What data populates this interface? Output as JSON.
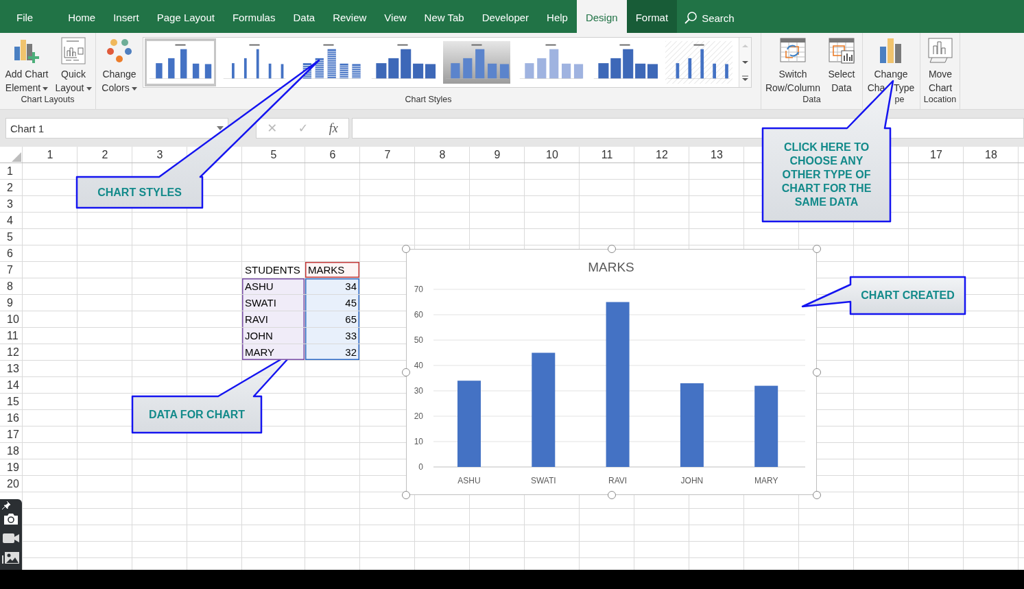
{
  "tabs": [
    {
      "label": "File",
      "selected": false,
      "contextual": false
    },
    {
      "label": "Home",
      "selected": false,
      "contextual": false
    },
    {
      "label": "Insert",
      "selected": false,
      "contextual": false
    },
    {
      "label": "Page Layout",
      "selected": false,
      "contextual": false
    },
    {
      "label": "Formulas",
      "selected": false,
      "contextual": false
    },
    {
      "label": "Data",
      "selected": false,
      "contextual": false
    },
    {
      "label": "Review",
      "selected": false,
      "contextual": false
    },
    {
      "label": "View",
      "selected": false,
      "contextual": false
    },
    {
      "label": "New Tab",
      "selected": false,
      "contextual": false
    },
    {
      "label": "Developer",
      "selected": false,
      "contextual": false
    },
    {
      "label": "Help",
      "selected": false,
      "contextual": false
    },
    {
      "label": "Design",
      "selected": true,
      "contextual": true
    },
    {
      "label": "Format",
      "selected": false,
      "contextual": true
    }
  ],
  "search": {
    "label": "Search"
  },
  "ribbon": {
    "groups": [
      {
        "label": "Chart Layouts",
        "buttons": [
          {
            "label": "Add Chart Element",
            "dropdown": true,
            "kind": "add-element"
          },
          {
            "label": "Quick Layout",
            "dropdown": true,
            "kind": "quick-layout"
          }
        ]
      },
      {
        "label": "Chart Styles",
        "buttons": [
          {
            "label": "Change Colors",
            "dropdown": true,
            "kind": "colors"
          }
        ],
        "gallery": [
          {
            "kind": "plain",
            "selected": true
          },
          {
            "kind": "labeled",
            "selected": false
          },
          {
            "kind": "striped",
            "selected": false
          },
          {
            "kind": "shadow",
            "selected": false
          },
          {
            "kind": "gradient",
            "selected": false
          },
          {
            "kind": "light",
            "selected": false
          },
          {
            "kind": "dark",
            "selected": false
          },
          {
            "kind": "hatched",
            "selected": false
          }
        ]
      },
      {
        "label": "Data",
        "buttons": [
          {
            "label": "Switch Row/Column",
            "kind": "switch"
          },
          {
            "label": "Select Data",
            "kind": "select-data"
          }
        ]
      },
      {
        "label": "pe",
        "buttons": [
          {
            "label": "Change Cha Type",
            "kind": "chart-type"
          }
        ]
      },
      {
        "label": "Location",
        "buttons": [
          {
            "label": "Move Chart",
            "kind": "move"
          }
        ]
      }
    ]
  },
  "formula_bar": {
    "name_box": "Chart 1",
    "buttons": [
      "✕",
      "✓",
      "fx"
    ]
  },
  "sheet": {
    "columns": [
      "1",
      "2",
      "3",
      null,
      "5",
      "6",
      "7",
      "8",
      "9",
      "10",
      "11",
      "12",
      "13",
      null,
      null,
      null,
      "17",
      "18"
    ],
    "rows": [
      "1",
      "2",
      "3",
      "4",
      "5",
      "6",
      "7",
      "8",
      "9",
      "10",
      "11",
      "12",
      "13",
      "14",
      "15",
      "16",
      "17",
      "18",
      "19",
      "20"
    ],
    "data_table": {
      "columns": [
        "STUDENTS",
        "MARKS"
      ],
      "rows": [
        [
          "ASHU",
          "34"
        ],
        [
          "SWATI",
          "45"
        ],
        [
          "RAVI",
          "65"
        ],
        [
          "JOHN",
          "33"
        ],
        [
          "MARY",
          "32"
        ]
      ]
    }
  },
  "chart": {
    "selected": true,
    "chart_data": {
      "type": "bar",
      "title": "MARKS",
      "categories": [
        "ASHU",
        "SWATI",
        "RAVI",
        "JOHN",
        "MARY"
      ],
      "series": [
        {
          "color": "#4472c4",
          "values": [
            34,
            45,
            65,
            33,
            32
          ]
        }
      ],
      "ylim": [
        0,
        70
      ],
      "yticks": [
        0,
        10,
        20,
        30,
        40,
        50,
        60,
        70
      ],
      "grid": true
    }
  },
  "callouts": [
    {
      "text": "CLICK HERE TO CHOOSE ANY OTHER TYPE OF CHART FOR THE SAME DATA"
    },
    {
      "text": "CHART STYLES"
    },
    {
      "text": "CHART CREATED"
    },
    {
      "text": "DATA FOR CHART"
    }
  ]
}
